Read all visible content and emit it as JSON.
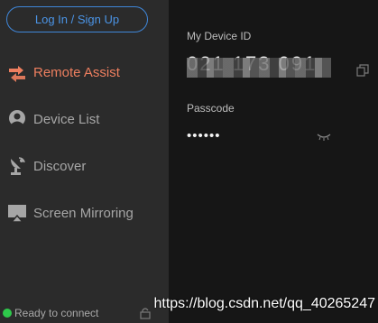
{
  "sidebar": {
    "login_label": "Log In / Sign Up",
    "items": [
      {
        "label": "Remote Assist",
        "icon": "remote-assist-icon",
        "active": true
      },
      {
        "label": "Device List",
        "icon": "device-list-icon",
        "active": false
      },
      {
        "label": "Discover",
        "icon": "discover-icon",
        "active": false
      },
      {
        "label": "Screen Mirroring",
        "icon": "screen-mirroring-icon",
        "active": false
      }
    ],
    "status": "Ready to connect"
  },
  "main": {
    "device_id_label": "My Device ID",
    "device_id_value": "021 173 091",
    "passcode_label": "Passcode",
    "passcode_value": "••••••"
  },
  "watermark": "https://blog.csdn.net/qq_40265247",
  "colors": {
    "accent_active": "#ee7f5f",
    "login_blue": "#4b94e6",
    "status_green": "#2ec94b",
    "sidebar_bg": "#2b2b2b",
    "main_bg": "#161616"
  }
}
